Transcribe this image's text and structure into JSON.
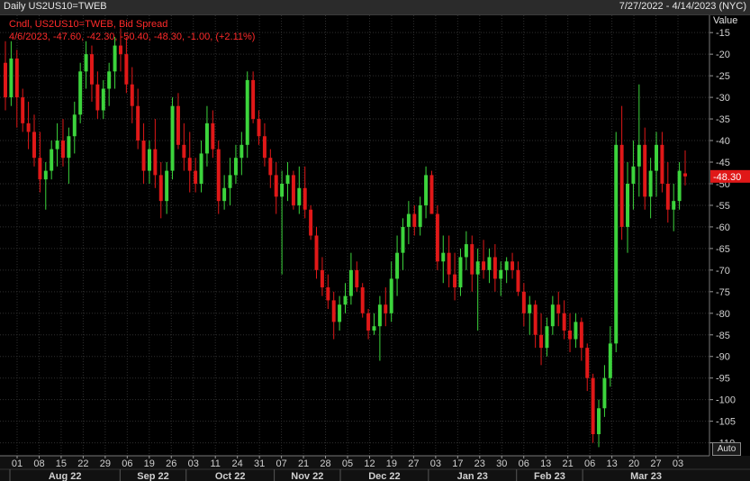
{
  "header": {
    "title": "Daily US2US10=TWEB",
    "range": "7/27/2022 - 4/14/2023 (NYC)"
  },
  "legend": {
    "line1": "Cndl, US2US10=TWEB, Bid Spread",
    "line2": "4/6/2023, -47.60, -42.30, -50.40, -48.30, -1.00, (+2.11%)"
  },
  "axis": {
    "value_title": "Value",
    "auto_label": "Auto"
  },
  "last_value_label": "-48.30",
  "colors": {
    "up": "#3cd43c",
    "down": "#e01818",
    "grid": "#2f2f2f",
    "last_tag": "#e01818"
  },
  "chart_data": {
    "type": "candlestick",
    "title": "Daily US2US10=TWEB",
    "ylabel": "Value",
    "ylim": [
      -113,
      -11
    ],
    "yticks": [
      -15,
      -20,
      -25,
      -30,
      -35,
      -40,
      -45,
      -50,
      -55,
      -60,
      -65,
      -70,
      -75,
      -80,
      -85,
      -90,
      -95,
      -100,
      -105,
      -110
    ],
    "xticks": [
      "01",
      "08",
      "15",
      "22",
      "29",
      "06",
      "19",
      "26",
      "03",
      "11",
      "24",
      "31",
      "07",
      "21",
      "28",
      "05",
      "12",
      "19",
      "27",
      "03",
      "17",
      "23",
      "30",
      "06",
      "13",
      "21",
      "06",
      "13",
      "20",
      "27",
      "03"
    ],
    "months": [
      "Aug 22",
      "Sep 22",
      "Oct 22",
      "Nov 22",
      "Dec 22",
      "Jan 23",
      "Feb 23",
      "Mar 23"
    ],
    "last_value": -48.3,
    "ohlc": [
      [
        -22,
        -17,
        -33,
        -30
      ],
      [
        -30,
        -17,
        -32,
        -21
      ],
      [
        -21,
        -19,
        -37,
        -30
      ],
      [
        -30,
        -28,
        -38,
        -36
      ],
      [
        -36,
        -31,
        -42,
        -38
      ],
      [
        -38,
        -34,
        -46,
        -44
      ],
      [
        -44,
        -38,
        -52,
        -49
      ],
      [
        -49,
        -45,
        -56,
        -47
      ],
      [
        -47,
        -40,
        -49,
        -42
      ],
      [
        -42,
        -36,
        -46,
        -40
      ],
      [
        -40,
        -35,
        -46,
        -44
      ],
      [
        -44,
        -37,
        -50,
        -39
      ],
      [
        -39,
        -31,
        -43,
        -34
      ],
      [
        -34,
        -22,
        -36,
        -24
      ],
      [
        -24,
        -17,
        -28,
        -20
      ],
      [
        -20,
        -18,
        -31,
        -27
      ],
      [
        -27,
        -24,
        -35,
        -33
      ],
      [
        -33,
        -26,
        -35,
        -28
      ],
      [
        -28,
        -22,
        -32,
        -24
      ],
      [
        -24,
        -16,
        -28,
        -18
      ],
      [
        -18,
        -14,
        -24,
        -20
      ],
      [
        -20,
        -16,
        -29,
        -27
      ],
      [
        -27,
        -23,
        -36,
        -32
      ],
      [
        -32,
        -28,
        -42,
        -40
      ],
      [
        -40,
        -36,
        -50,
        -47
      ],
      [
        -47,
        -40,
        -50,
        -42
      ],
      [
        -42,
        -35,
        -51,
        -48
      ],
      [
        -48,
        -45,
        -58,
        -54
      ],
      [
        -54,
        -45,
        -57,
        -47
      ],
      [
        -47,
        -30,
        -49,
        -32
      ],
      [
        -32,
        -29,
        -42,
        -41
      ],
      [
        -41,
        -36,
        -47,
        -44
      ],
      [
        -44,
        -38,
        -52,
        -47
      ],
      [
        -47,
        -44,
        -52,
        -50
      ],
      [
        -50,
        -40,
        -52,
        -43
      ],
      [
        -43,
        -32,
        -46,
        -36
      ],
      [
        -36,
        -33,
        -44,
        -42
      ],
      [
        -42,
        -40,
        -57,
        -54
      ],
      [
        -54,
        -48,
        -56,
        -51
      ],
      [
        -51,
        -44,
        -55,
        -48
      ],
      [
        -48,
        -41,
        -50,
        -44
      ],
      [
        -44,
        -38,
        -48,
        -41
      ],
      [
        -41,
        -24,
        -44,
        -26
      ],
      [
        -26,
        -24,
        -36,
        -35
      ],
      [
        -35,
        -33,
        -41,
        -39
      ],
      [
        -39,
        -36,
        -46,
        -44
      ],
      [
        -44,
        -42,
        -51,
        -48
      ],
      [
        -48,
        -45,
        -57,
        -53
      ],
      [
        -53,
        -47,
        -71,
        -50
      ],
      [
        -50,
        -45,
        -54,
        -48
      ],
      [
        -48,
        -47,
        -56,
        -55
      ],
      [
        -55,
        -46,
        -57,
        -51
      ],
      [
        -51,
        -46,
        -58,
        -56
      ],
      [
        -56,
        -55,
        -63,
        -62
      ],
      [
        -62,
        -60,
        -72,
        -70
      ],
      [
        -70,
        -67,
        -76,
        -74
      ],
      [
        -74,
        -71,
        -79,
        -77
      ],
      [
        -77,
        -75,
        -86,
        -82
      ],
      [
        -82,
        -76,
        -84,
        -78
      ],
      [
        -78,
        -73,
        -80,
        -76
      ],
      [
        -76,
        -66,
        -78,
        -70
      ],
      [
        -70,
        -68,
        -75,
        -74
      ],
      [
        -74,
        -73,
        -81,
        -80
      ],
      [
        -80,
        -79,
        -86,
        -84
      ],
      [
        -84,
        -80,
        -85,
        -83
      ],
      [
        -83,
        -76,
        -91,
        -78
      ],
      [
        -78,
        -74,
        -83,
        -80
      ],
      [
        -80,
        -68,
        -82,
        -72
      ],
      [
        -72,
        -62,
        -76,
        -66
      ],
      [
        -66,
        -58,
        -70,
        -60
      ],
      [
        -60,
        -54,
        -64,
        -57
      ],
      [
        -57,
        -55,
        -62,
        -60
      ],
      [
        -60,
        -53,
        -62,
        -55
      ],
      [
        -55,
        -46,
        -58,
        -48
      ],
      [
        -48,
        -47,
        -56,
        -57
      ],
      [
        -57,
        -55,
        -70,
        -68
      ],
      [
        -68,
        -62,
        -73,
        -66
      ],
      [
        -66,
        -62,
        -74,
        -71
      ],
      [
        -71,
        -66,
        -77,
        -74
      ],
      [
        -74,
        -65,
        -76,
        -67
      ],
      [
        -67,
        -61,
        -70,
        -64
      ],
      [
        -64,
        -62,
        -75,
        -71
      ],
      [
        -71,
        -65,
        -84,
        -68
      ],
      [
        -68,
        -63,
        -72,
        -70
      ],
      [
        -70,
        -65,
        -73,
        -67
      ],
      [
        -67,
        -64,
        -75,
        -72
      ],
      [
        -72,
        -68,
        -76,
        -70
      ],
      [
        -70,
        -67,
        -73,
        -68
      ],
      [
        -68,
        -66,
        -72,
        -70
      ],
      [
        -70,
        -68,
        -76,
        -75
      ],
      [
        -75,
        -73,
        -83,
        -80
      ],
      [
        -80,
        -76,
        -85,
        -78
      ],
      [
        -78,
        -77,
        -88,
        -85
      ],
      [
        -85,
        -80,
        -92,
        -88
      ],
      [
        -88,
        -81,
        -90,
        -83
      ],
      [
        -83,
        -76,
        -85,
        -78
      ],
      [
        -78,
        -75,
        -83,
        -80
      ],
      [
        -80,
        -77,
        -86,
        -84
      ],
      [
        -84,
        -80,
        -89,
        -86
      ],
      [
        -86,
        -80,
        -88,
        -82
      ],
      [
        -82,
        -81,
        -91,
        -88
      ],
      [
        -88,
        -87,
        -98,
        -95
      ],
      [
        -95,
        -94,
        -110,
        -108
      ],
      [
        -108,
        -100,
        -111,
        -102
      ],
      [
        -102,
        -92,
        -104,
        -95
      ],
      [
        -95,
        -83,
        -97,
        -87
      ],
      [
        -87,
        -38,
        -89,
        -41
      ],
      [
        -41,
        -32,
        -63,
        -60
      ],
      [
        -60,
        -45,
        -66,
        -50
      ],
      [
        -50,
        -40,
        -56,
        -46
      ],
      [
        -46,
        -27,
        -53,
        -41
      ],
      [
        -41,
        -37,
        -56,
        -53
      ],
      [
        -53,
        -44,
        -58,
        -47
      ],
      [
        -47,
        -38,
        -53,
        -41
      ],
      [
        -41,
        -38,
        -52,
        -50
      ],
      [
        -50,
        -45,
        -59,
        -56
      ],
      [
        -56,
        -50,
        -61,
        -54
      ],
      [
        -54,
        -45,
        -56,
        -47
      ],
      [
        -47.6,
        -42.3,
        -50.4,
        -48.3
      ]
    ]
  }
}
